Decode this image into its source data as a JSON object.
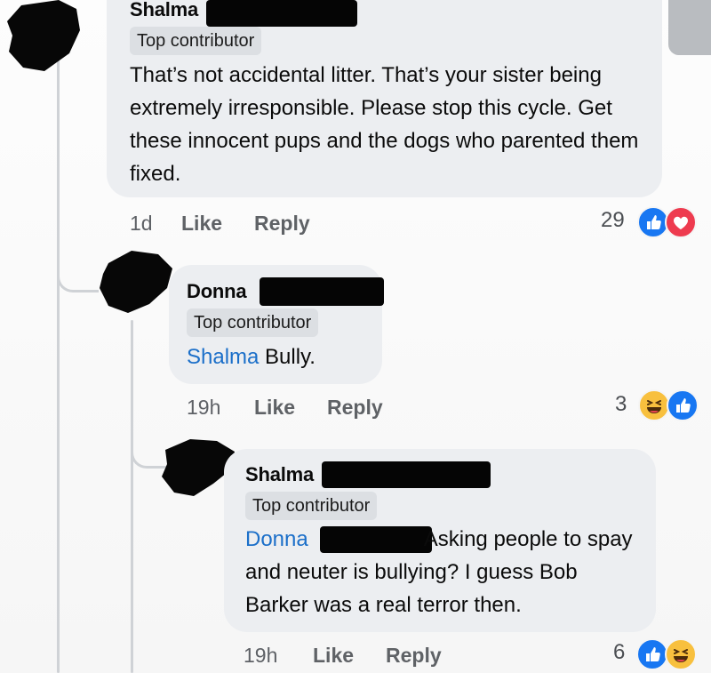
{
  "comments": [
    {
      "author": "Shalma",
      "badge": "Top contributor",
      "mention": "",
      "text": "That’s not accidental litter. That’s your sister being extremely irresponsible. Please stop this cycle. Get these innocent pups and the dogs who parented them fixed.",
      "time": "1d",
      "like_label": "Like",
      "reply_label": "Reply",
      "reaction_count": "29",
      "reactions": [
        "like-icon",
        "love-icon"
      ]
    },
    {
      "author": "Donna",
      "badge": "Top contributor",
      "mention": "Shalma",
      "text": "Bully.",
      "time": "19h",
      "like_label": "Like",
      "reply_label": "Reply",
      "reaction_count": "3",
      "reactions": [
        "haha-icon",
        "like-icon"
      ]
    },
    {
      "author": "Shalma",
      "badge": "Top contributor",
      "mention": "Donna",
      "text": "Asking people to spay and neuter is bullying? I guess Bob Barker was a real terror then.",
      "time": "19h",
      "like_label": "Like",
      "reply_label": "Reply",
      "reaction_count": "6",
      "reactions": [
        "like-icon",
        "haha-icon"
      ]
    }
  ],
  "colors": {
    "bubble": "#eceef1",
    "mention": "#1b6fc9",
    "like": "#1877f2",
    "love": "#ee3b4f",
    "haha": "#f8c03e"
  }
}
